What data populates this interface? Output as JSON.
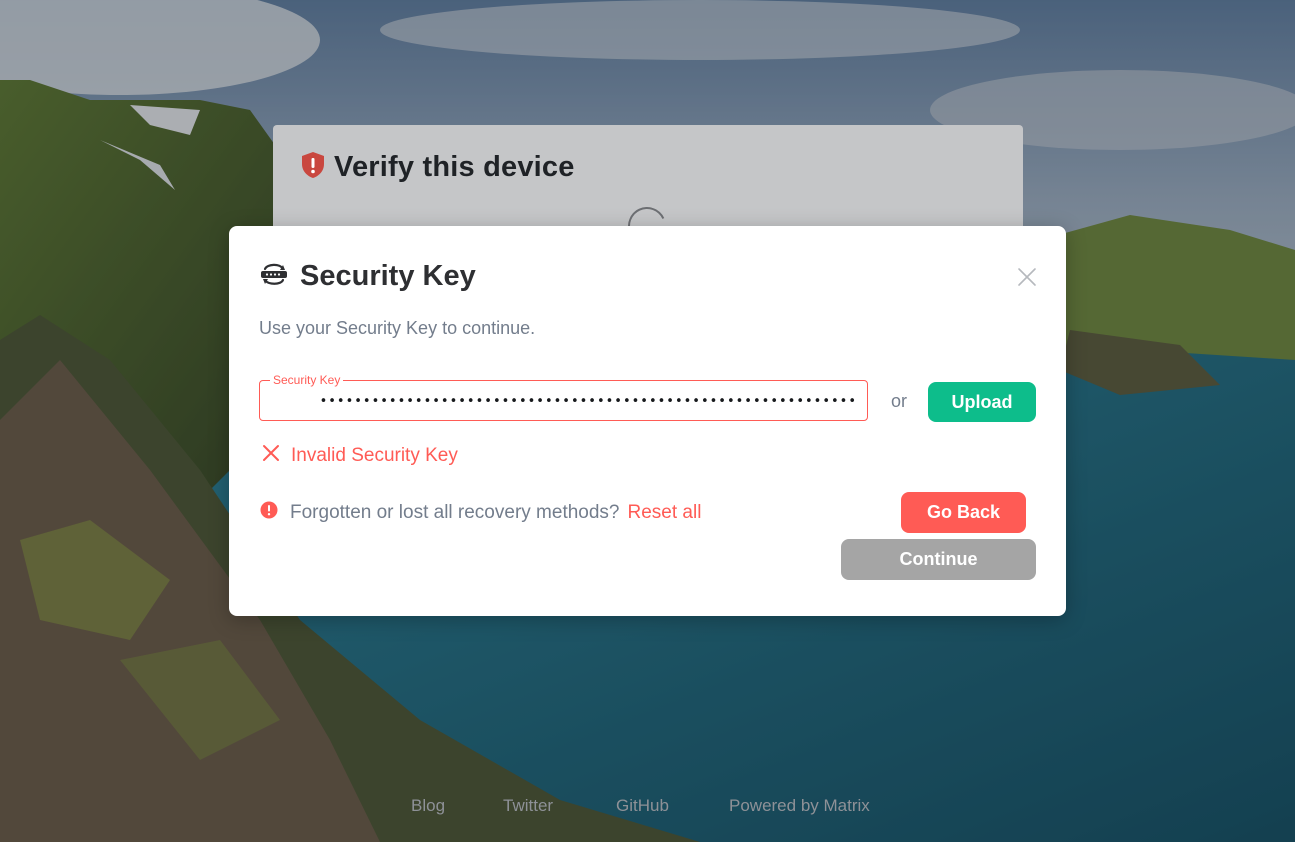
{
  "background_panel": {
    "title": "Verify this device"
  },
  "dialog": {
    "title": "Security Key",
    "description": "Use your Security Key to continue.",
    "key_field": {
      "label": "Security Key",
      "value": "••••••••••••••••••••••••••••••••••••••••••••••••••••••••••••••"
    },
    "or_text": "or",
    "upload_label": "Upload",
    "error_text": "Invalid Security Key",
    "reset_prompt": "Forgotten or lost all recovery methods?",
    "reset_link": "Reset all",
    "go_back_label": "Go Back",
    "continue_label": "Continue"
  },
  "footer": {
    "links": [
      "Blog",
      "Twitter",
      "GitHub",
      "Powered by Matrix"
    ]
  },
  "colors": {
    "accent": "#0dbd8b",
    "alert": "#ff5b55",
    "disabled": "#a5a5a5"
  },
  "icons": {
    "verify": "shield-alert-icon",
    "security_key": "key-icon",
    "close": "close-icon",
    "error": "cross-icon",
    "warning": "exclamation-circle-icon"
  }
}
